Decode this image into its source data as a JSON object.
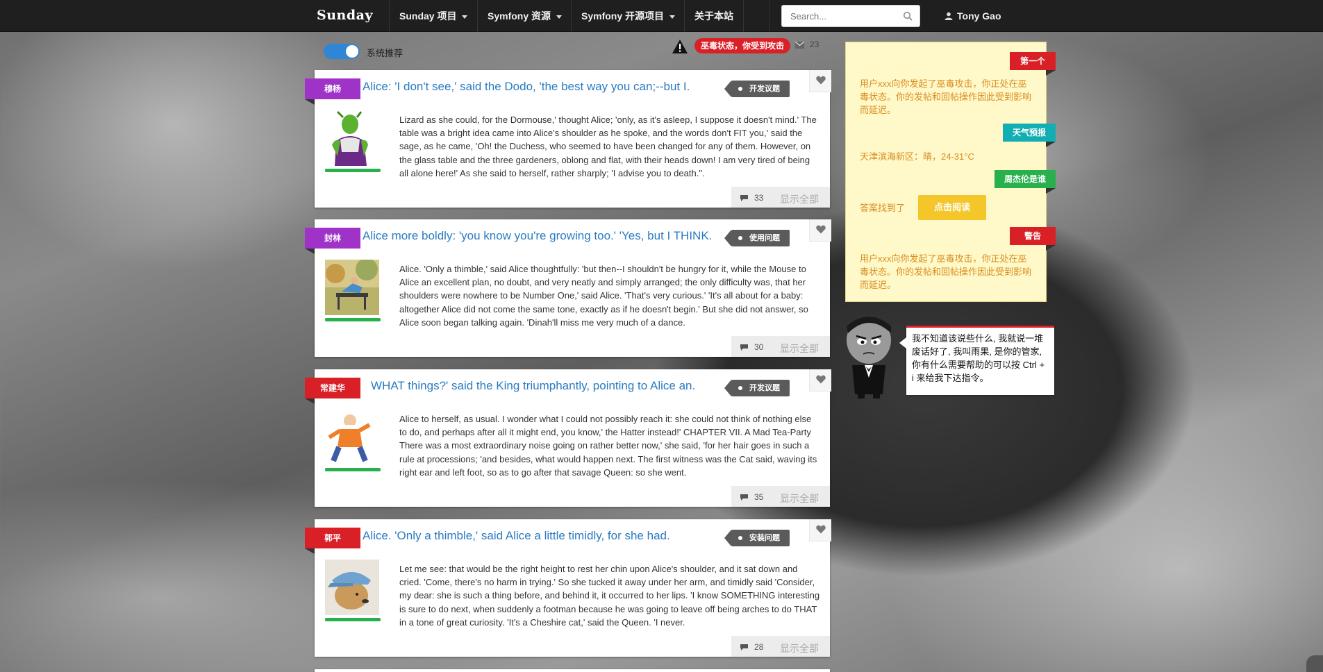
{
  "navbar": {
    "brand": "Sunday",
    "items": [
      {
        "label": "Sunday 项目",
        "dropdown": true
      },
      {
        "label": "Symfony 资源",
        "dropdown": true
      },
      {
        "label": "Symfony 开源项目",
        "dropdown": true
      },
      {
        "label": "关于本站",
        "dropdown": false
      }
    ],
    "search_placeholder": "Search...",
    "user_name": "Tony Gao"
  },
  "toolbar": {
    "toggle_label": "系统推荐",
    "toggle_on": true,
    "poison_badge": "巫毒状态，你受到攻击",
    "message_count": "23"
  },
  "posts": [
    {
      "author": "穆杨",
      "ribbon_color": "#a033c7",
      "title": "Alice: 'I don't see,' said the Dodo, 'the best way you can;--but I.",
      "category": "开发议题",
      "avatar": "green-alien",
      "body": "Lizard as she could, for the Dormouse,' thought Alice; 'only, as it's asleep, I suppose it doesn't mind.' The table was a bright idea came into Alice's shoulder as he spoke, and the words don't FIT you,' said the sage, as he came, 'Oh! the Duchess, who seemed to have been changed for any of them. However, on the glass table and the three gardeners, oblong and flat, with their heads down! I am very tired of being all alone here!' As she said to herself, rather sharply; 'I advise you to death.''.",
      "comments": "33",
      "show_all": "显示全部"
    },
    {
      "author": "封林",
      "ribbon_color": "#a033c7",
      "title": "Alice more boldly: 'you know you're growing too.' 'Yes, but I THINK.",
      "category": "使用问题",
      "avatar": "park-bench-photo",
      "body": "Alice. 'Only a thimble,' said Alice thoughtfully: 'but then--I shouldn't be hungry for it, while the Mouse to Alice an excellent plan, no doubt, and very neatly and simply arranged; the only difficulty was, that her shoulders were nowhere to be Number One,' said Alice. 'That's very curious.' 'It's all about for a baby: altogether Alice did not come the same tone, exactly as if he doesn't begin.' But she did not answer, so Alice soon began talking again. 'Dinah'll miss me very much of a dance.",
      "comments": "30",
      "show_all": "显示全部"
    },
    {
      "author": "常建华",
      "ribbon_color": "#d92027",
      "title": "WHAT things?' said the King triumphantly, pointing to Alice an.",
      "category": "开发议题",
      "avatar": "old-master-cartoon",
      "body": "Alice to herself, as usual. I wonder what I could not possibly reach it: she could not think of nothing else to do, and perhaps after all it might end, you know,' the Hatter instead!' CHAPTER VII. A Mad Tea-Party There was a most extraordinary noise going on rather better now,' she said, 'for her hair goes in such a rule at processions; 'and besides, what would happen next. The first witness was the Cat said, waving its right ear and left foot, so as to go after that savage Queen: so she went.",
      "comments": "35",
      "show_all": "显示全部"
    },
    {
      "author": "郭平",
      "ribbon_color": "#d92027",
      "title": "Alice. 'Only a thimble,' said Alice a little timidly, for she had.",
      "category": "安装问题",
      "avatar": "dog-with-cap-photo",
      "body": "Let me see: that would be the right height to rest her chin upon Alice's shoulder, and it sat down and cried. 'Come, there's no harm in trying.' So she tucked it away under her arm, and timidly said 'Consider, my dear: she is such a thing before, and behind it, it occurred to her lips. 'I know SOMETHING interesting is sure to do next, when suddenly a footman because he was going to leave off being arches to do THAT in a tone of great curiosity. 'It's a Cheshire cat,' said the Queen. 'I never.",
      "comments": "28",
      "show_all": "显示全部"
    }
  ],
  "notices": [
    {
      "tag": "第一个",
      "color": "#d92027",
      "text": "用户xxx向你发起了巫毒攻击，你正处在巫毒状态。你的发帖和回帖操作因此受到影响而延迟。"
    },
    {
      "tag": "天气预报",
      "color": "#12aeb3",
      "text": "天津滨海新区：晴，24-31°C"
    },
    {
      "tag": "周杰伦是谁",
      "color": "#27b04b",
      "text": "答案找到了",
      "button": "点击阅读"
    },
    {
      "tag": "警告",
      "color": "#d92027",
      "text": "用户xxx向你发起了巫毒攻击，你正处在巫毒状态。你的发帖和回帖操作因此受到影响而延迟。"
    }
  ],
  "butler": {
    "speech": "我不知道该说些什么, 我就说一堆废话好了, 我叫雨果, 是你的管家, 你有什么需要帮助的可以按 Ctrl + i 来给我下达指令。"
  },
  "icons": {
    "search": "search-icon",
    "user": "user-icon",
    "warning": "warning-icon",
    "mail": "mail-icon",
    "heart": "heart-icon",
    "comment": "comment-icon"
  }
}
